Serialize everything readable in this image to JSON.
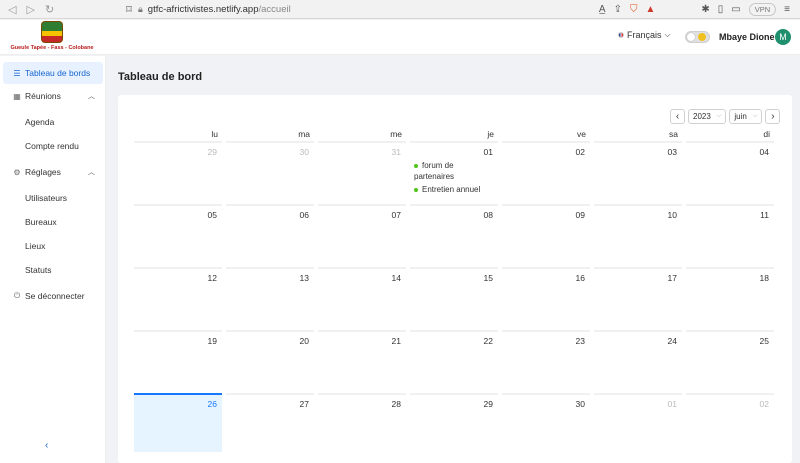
{
  "browser": {
    "url_domain": "gtfc-africtivistes.netlify.app",
    "url_path": "/accueil",
    "vpn_label": "VPN"
  },
  "header": {
    "logo_text": "Gueule Tapée - Fass - Colobane",
    "language": "Français",
    "user_name": "Mbaye Dione",
    "avatar_letter": "M"
  },
  "sidebar": {
    "items": [
      {
        "label": "Tableau de bords",
        "icon": "list-icon"
      },
      {
        "label": "Réunions",
        "icon": "calendar-icon"
      },
      {
        "label": "Agenda"
      },
      {
        "label": "Compte rendu"
      },
      {
        "label": "Réglages",
        "icon": "gear-icon"
      },
      {
        "label": "Utilisateurs"
      },
      {
        "label": "Bureaux"
      },
      {
        "label": "Lieux"
      },
      {
        "label": "Statuts"
      },
      {
        "label": "Se déconnecter",
        "icon": "logout-icon"
      }
    ],
    "collapse_icon": "‹"
  },
  "main": {
    "title": "Tableau de bord"
  },
  "calendar": {
    "year": "2023",
    "month": "juin",
    "weekdays": [
      "lu",
      "ma",
      "me",
      "je",
      "ve",
      "sa",
      "di"
    ],
    "weeks": [
      [
        {
          "d": "29",
          "muted": true
        },
        {
          "d": "30",
          "muted": true
        },
        {
          "d": "31",
          "muted": true
        },
        {
          "d": "01",
          "events": [
            "forum de partenaires",
            "Entretien annuel"
          ]
        },
        {
          "d": "02"
        },
        {
          "d": "03"
        },
        {
          "d": "04"
        }
      ],
      [
        {
          "d": "05"
        },
        {
          "d": "06"
        },
        {
          "d": "07"
        },
        {
          "d": "08"
        },
        {
          "d": "09"
        },
        {
          "d": "10"
        },
        {
          "d": "11"
        }
      ],
      [
        {
          "d": "12"
        },
        {
          "d": "13"
        },
        {
          "d": "14"
        },
        {
          "d": "15"
        },
        {
          "d": "16"
        },
        {
          "d": "17"
        },
        {
          "d": "18"
        }
      ],
      [
        {
          "d": "19"
        },
        {
          "d": "20"
        },
        {
          "d": "21"
        },
        {
          "d": "22"
        },
        {
          "d": "23"
        },
        {
          "d": "24"
        },
        {
          "d": "25"
        }
      ],
      [
        {
          "d": "26",
          "today": true
        },
        {
          "d": "27"
        },
        {
          "d": "28"
        },
        {
          "d": "29"
        },
        {
          "d": "30"
        },
        {
          "d": "01",
          "muted": true
        },
        {
          "d": "02",
          "muted": true
        }
      ]
    ]
  }
}
